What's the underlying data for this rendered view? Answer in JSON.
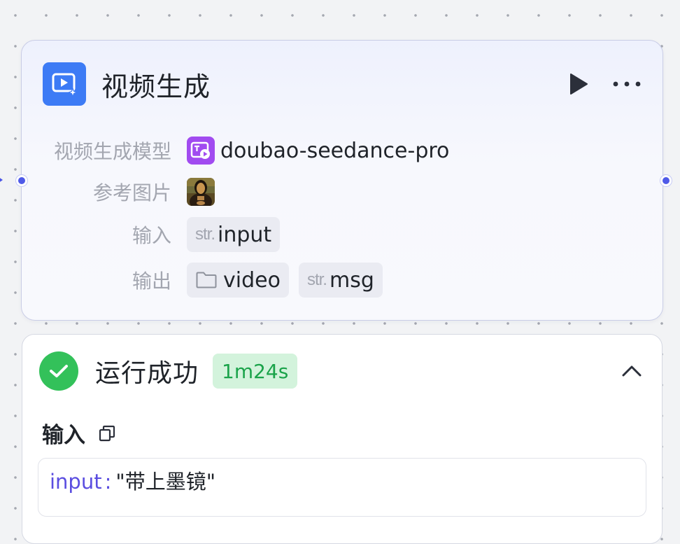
{
  "node": {
    "title": "视频生成",
    "icon": "video-spark-icon",
    "accent_color": "#3d7bf5",
    "params": {
      "model_label": "视频生成模型",
      "model_name": "doubao-seedance-pro",
      "model_icon_color": "#a14bf0",
      "ref_image_label": "参考图片",
      "input_label": "输入",
      "inputs": [
        {
          "type": "str.",
          "name": "input"
        }
      ],
      "output_label": "输出",
      "outputs": [
        {
          "type": "folder",
          "name": "video"
        },
        {
          "type": "str.",
          "name": "msg"
        }
      ]
    }
  },
  "result": {
    "status": "运行成功",
    "status_color": "#33c15a",
    "duration": "1m24s",
    "input_section_title": "输入",
    "input_key": "input",
    "input_separator": ":",
    "input_value": "\"带上墨镜\""
  }
}
